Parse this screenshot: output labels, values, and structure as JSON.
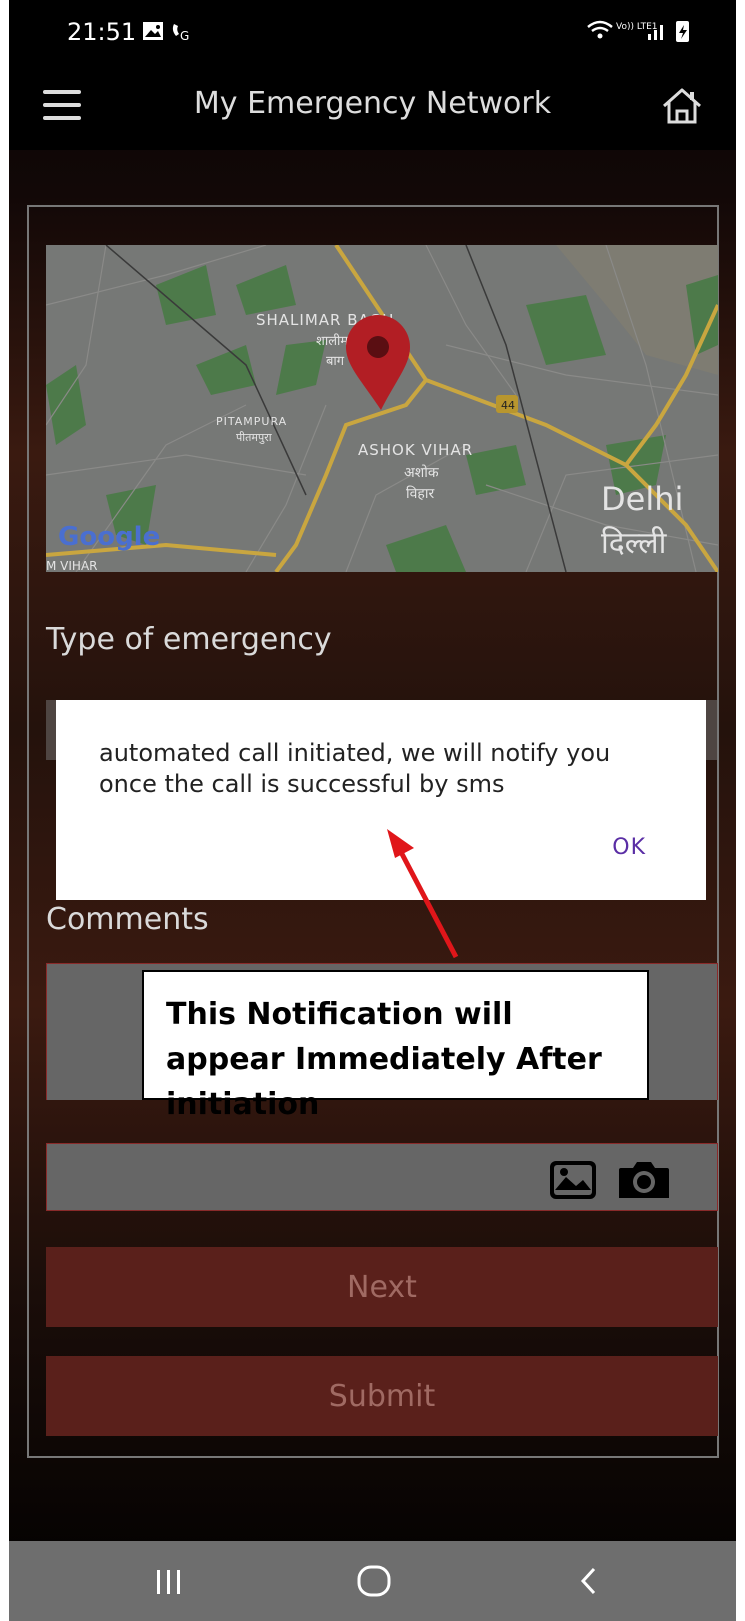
{
  "status_bar": {
    "time": "21:51",
    "network_label": "Vo)) LTE1"
  },
  "app_bar": {
    "title": "My Emergency Network"
  },
  "map": {
    "places": {
      "shalimar_bagh": "SHALIMAR BAGH",
      "shalimar_bagh_hi_1": "शालीमार",
      "shalimar_bagh_hi_2": "बाग",
      "pitampura": "PITAMPURA",
      "pitampura_hi": "पीतमपुरा",
      "ashok_vihar": "ASHOK VIHAR",
      "ashok_vihar_hi_1": "अशोक",
      "ashok_vihar_hi_2": "विहार",
      "delhi": "Delhi",
      "delhi_hi": "दिल्ली",
      "m_vihar": "M VIHAR"
    },
    "highway_number": "44",
    "attribution": "Google"
  },
  "form": {
    "type_label": "Type of emergency",
    "comments_label": "Comments",
    "next_label": "Next",
    "submit_label": "Submit"
  },
  "dialog": {
    "message": "automated call initiated, we will notify you once the call is successful by sms",
    "ok_label": "OK"
  },
  "annotation": {
    "text": "This Notification will appear Immediately After initiation",
    "arrow_color": "#e0161a"
  },
  "colors": {
    "button_bg": "#5a201b",
    "dialog_button": "#5a2ea5",
    "border_accent": "#8a2a2a"
  }
}
